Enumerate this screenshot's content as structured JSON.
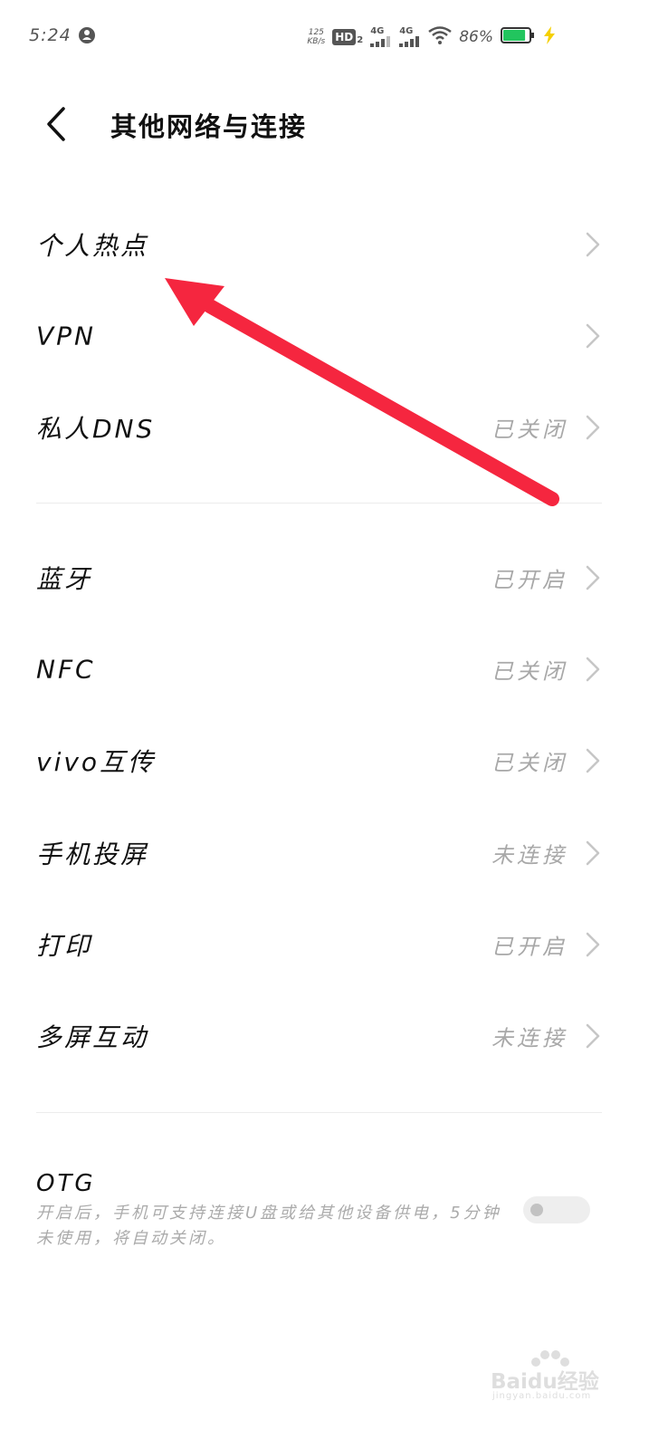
{
  "status_bar": {
    "time": "5:24",
    "net_speed_value": "125",
    "net_speed_unit": "KB/s",
    "hd_badge": "HD",
    "hd_sub": "2",
    "sim1_type": "4G",
    "sim2_type": "4G",
    "battery_percent": "86%",
    "battery_level": 0.86,
    "battery_color": "#22c55e",
    "charging_color": "#f5d000"
  },
  "header": {
    "back_icon": "chevron-left-icon",
    "title": "其他网络与连接"
  },
  "group1": [
    {
      "label": "个人热点",
      "status": ""
    },
    {
      "label": "VPN",
      "status": ""
    },
    {
      "label": "私人DNS",
      "status": "已关闭"
    }
  ],
  "group2": [
    {
      "label": "蓝牙",
      "status": "已开启"
    },
    {
      "label": "NFC",
      "status": "已关闭"
    },
    {
      "label": "vivo互传",
      "status": "已关闭"
    },
    {
      "label": "手机投屏",
      "status": "未连接"
    },
    {
      "label": "打印",
      "status": "已开启"
    },
    {
      "label": "多屏互动",
      "status": "未连接"
    }
  ],
  "otg": {
    "label": "OTG",
    "description": "开启后，手机可支持连接U盘或给其他设备供电，5分钟未使用，将自动关闭。",
    "enabled": false
  },
  "annotation": {
    "color": "#f5263f"
  },
  "watermark": {
    "text": "Baidu经验",
    "url": "jingyan.baidu.com"
  }
}
